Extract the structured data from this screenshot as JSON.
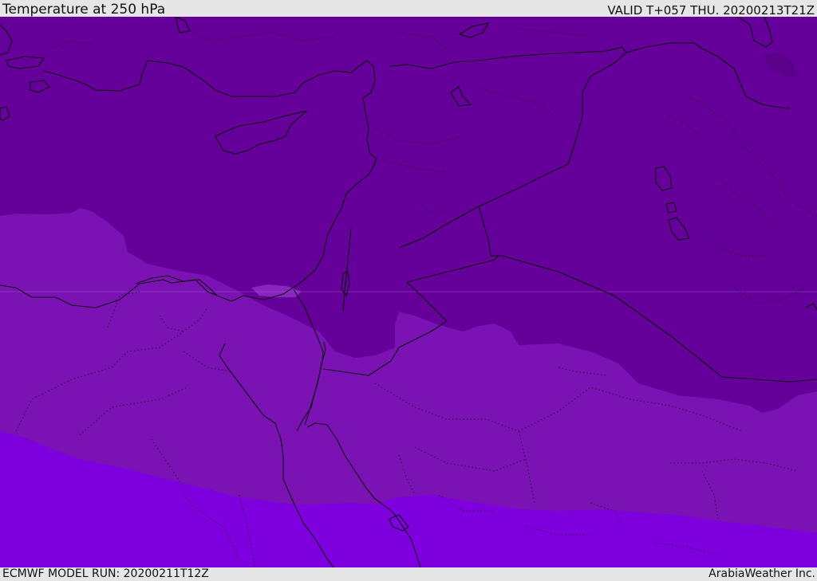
{
  "header": {
    "title": "Temperature at 250 hPa",
    "valid": "VALID T+057 THU. 20200213T21Z"
  },
  "footer": {
    "model_run": "ECMWF MODEL RUN: 20200211T12Z",
    "credit": "ArabiaWeather Inc."
  },
  "colors": {
    "band_cold": "#65009a",
    "band_mid": "#7a12b4",
    "band_warm": "#7e00de",
    "patch_light": "#8a26c0",
    "coastline": "#111111",
    "background": "#e6e6e6"
  }
}
